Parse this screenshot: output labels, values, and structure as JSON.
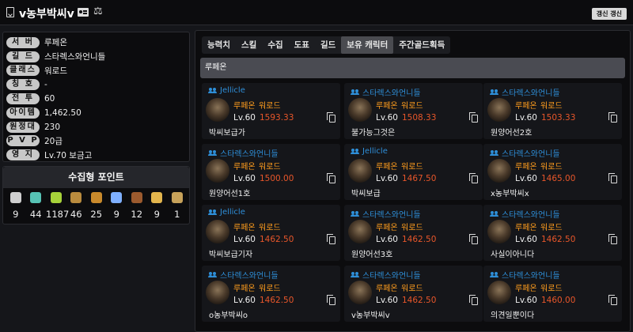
{
  "header": {
    "name": "v농부박씨v",
    "refresh_label": "갱신 갱신"
  },
  "info": [
    {
      "label": "서 버",
      "value": "루페온"
    },
    {
      "label": "길 드",
      "value": "스타렉스와언니들"
    },
    {
      "label": "클래스",
      "value": "워로드"
    },
    {
      "label": "칭 호",
      "value": "-"
    },
    {
      "label": "전 투",
      "value": "60"
    },
    {
      "label": "아이템",
      "value": "1,462.50"
    },
    {
      "label": "원정대",
      "value": "230"
    },
    {
      "label": "P V P",
      "value": "20급"
    },
    {
      "label": "영 지",
      "value": "Lv.70 보금고"
    }
  ],
  "collection": {
    "title": "수집형 포인트",
    "items": [
      {
        "icon": "island-heart-icon",
        "color": "#cfcfcf",
        "count": "9"
      },
      {
        "icon": "mokoko-seed-icon",
        "color": "#57c3b5",
        "count": "44"
      },
      {
        "icon": "mokoko-sprout-icon",
        "color": "#a7d23a",
        "count": "1187"
      },
      {
        "icon": "adventure-map-icon",
        "color": "#b98b3e",
        "count": "46"
      },
      {
        "icon": "great-art-icon",
        "color": "#c98a2c",
        "count": "25"
      },
      {
        "icon": "giant-heart-icon",
        "color": "#7fb0ff",
        "count": "9"
      },
      {
        "icon": "ignea-token-icon",
        "color": "#9b5a2e",
        "count": "12"
      },
      {
        "icon": "orpheus-star-icon",
        "color": "#e3b54d",
        "count": "9"
      },
      {
        "icon": "world-tree-leaf-icon",
        "color": "#c7a25a",
        "count": "1"
      }
    ]
  },
  "tabs": [
    "능력치",
    "스킬",
    "수집",
    "도표",
    "길드",
    "보유 캐릭터",
    "주간골드획득"
  ],
  "active_tab": 5,
  "server_bar": "루페온",
  "characters": [
    {
      "guild": "Jellicle",
      "server": "루페온",
      "class": "워로드",
      "level": "Lv.60",
      "ilvl": "1593.33",
      "name": "박씨보급가"
    },
    {
      "guild": "스타렉스와언니들",
      "server": "루페온",
      "class": "워로드",
      "level": "Lv.60",
      "ilvl": "1508.33",
      "name": "불가능그것은"
    },
    {
      "guild": "스타렉스와언니들",
      "server": "루페온",
      "class": "워로드",
      "level": "Lv.60",
      "ilvl": "1503.33",
      "name": "원양어선2호"
    },
    {
      "guild": "스타렉스와언니들",
      "server": "루페온",
      "class": "워로드",
      "level": "Lv.60",
      "ilvl": "1500.00",
      "name": "원양어선1호"
    },
    {
      "guild": "Jellicle",
      "server": "루페온",
      "class": "워로드",
      "level": "Lv.60",
      "ilvl": "1467.50",
      "name": "박씨보급"
    },
    {
      "guild": "스타렉스와언니들",
      "server": "루페온",
      "class": "워로드",
      "level": "Lv.60",
      "ilvl": "1465.00",
      "name": "x농부박씨x"
    },
    {
      "guild": "Jellicle",
      "server": "루페온",
      "class": "워로드",
      "level": "Lv.60",
      "ilvl": "1462.50",
      "name": "박씨보급기자"
    },
    {
      "guild": "스타렉스와언니들",
      "server": "루페온",
      "class": "워로드",
      "level": "Lv.60",
      "ilvl": "1462.50",
      "name": "원양어선3호"
    },
    {
      "guild": "스타렉스와언니들",
      "server": "루페온",
      "class": "워로드",
      "level": "Lv.60",
      "ilvl": "1462.50",
      "name": "사실이아니다"
    },
    {
      "guild": "스타렉스와언니들",
      "server": "루페온",
      "class": "워로드",
      "level": "Lv.60",
      "ilvl": "1462.50",
      "name": "o농부박씨o"
    },
    {
      "guild": "스타렉스와언니들",
      "server": "루페온",
      "class": "워로드",
      "level": "Lv.60",
      "ilvl": "1462.50",
      "name": "v농부박씨v"
    },
    {
      "guild": "스타렉스와언니들",
      "server": "루페온",
      "class": "워로드",
      "level": "Lv.60",
      "ilvl": "1460.00",
      "name": "의견일뿐이다"
    }
  ]
}
